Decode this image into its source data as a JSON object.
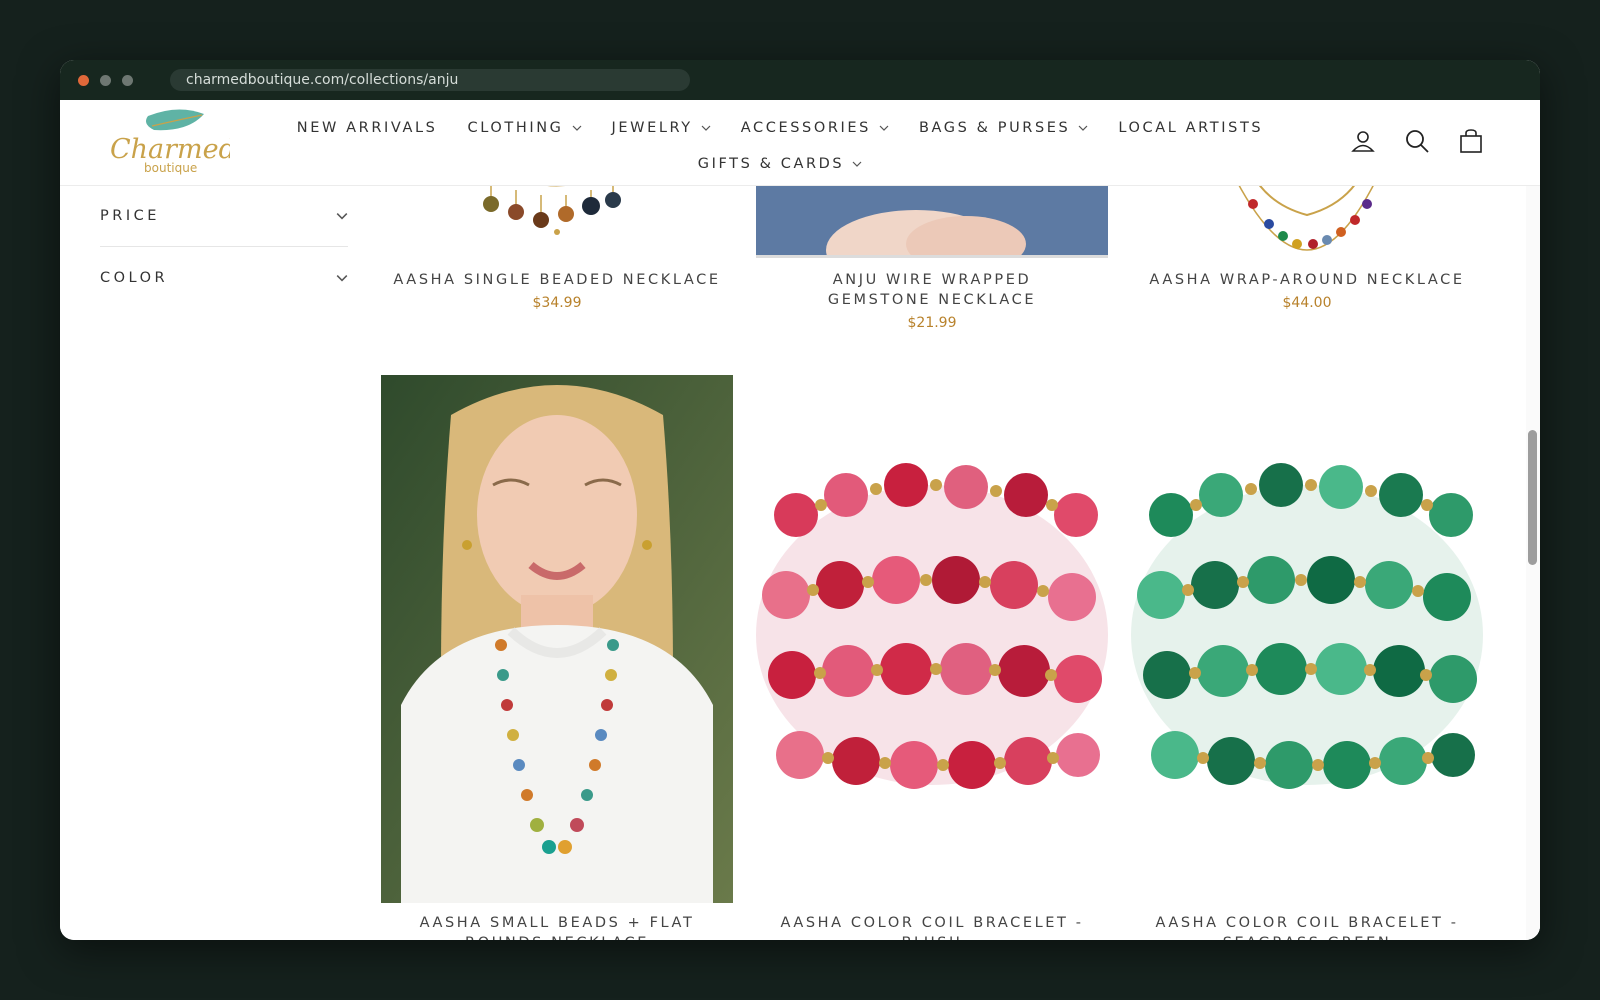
{
  "browser": {
    "url": "charmedboutique.com/collections/anju"
  },
  "header": {
    "logo_text": "Charmed",
    "logo_subtext": "boutique",
    "nav": [
      {
        "label": "NEW ARRIVALS"
      },
      {
        "label": "CLOTHING"
      },
      {
        "label": "JEWELRY"
      },
      {
        "label": "ACCESSORIES"
      },
      {
        "label": "BAGS & PURSES"
      },
      {
        "label": "LOCAL ARTISTS"
      },
      {
        "label": "GIFTS & CARDS"
      }
    ],
    "icons": [
      "account-icon",
      "search-icon",
      "cart-icon"
    ]
  },
  "sidebar": {
    "filters": [
      {
        "label": "PRICE"
      },
      {
        "label": "COLOR"
      }
    ]
  },
  "products": [
    {
      "name": "AASHA SINGLE BEADED NECKLACE",
      "price": "$34.99"
    },
    {
      "name": "ANJU WIRE WRAPPED GEMSTONE NECKLACE",
      "price": "$21.99"
    },
    {
      "name": "AASHA WRAP-AROUND NECKLACE",
      "price": "$44.00"
    },
    {
      "name": "AASHA SMALL BEADS + FLAT ROUNDS NECKLACE",
      "price": ""
    },
    {
      "name": "AASHA COLOR COIL BRACELET - BLUSH",
      "price": ""
    },
    {
      "name": "AASHA COLOR COIL BRACELET - SEAGRASS GREEN",
      "price": ""
    }
  ],
  "colors": {
    "accent_price": "#b8822c",
    "logo_teal": "#5fb3a5",
    "logo_gold": "#c9a24a"
  }
}
